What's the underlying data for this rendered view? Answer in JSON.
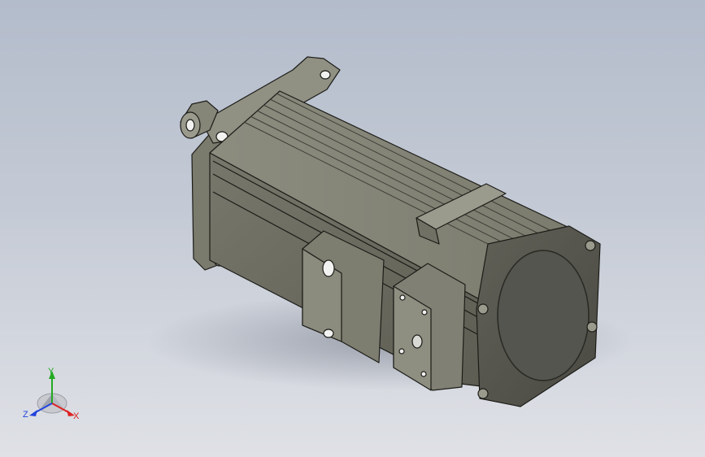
{
  "viewport": {
    "background_top": "#b3bccb",
    "background_bottom": "#dfe1e6"
  },
  "model": {
    "body_color": "#6e6e62",
    "edge_color": "#1c1c18"
  },
  "triad": {
    "labels": {
      "y": "Y",
      "z": "Z",
      "x": "X"
    },
    "colors": {
      "y": "#22aa22",
      "z": "#2244dd",
      "x": "#dd2222"
    }
  }
}
